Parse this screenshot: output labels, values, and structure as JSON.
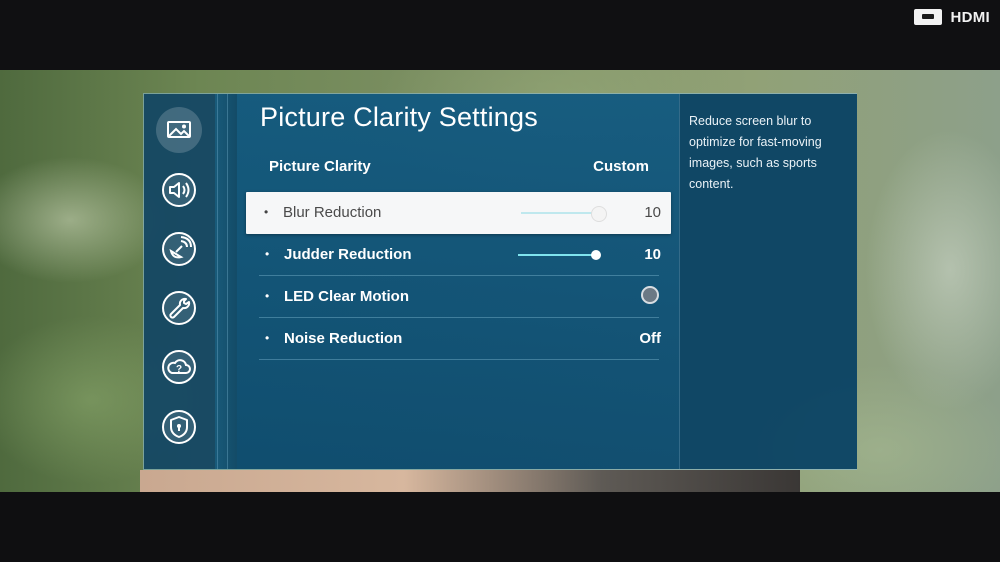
{
  "input_source": {
    "label": "HDMI",
    "icon": "hdmi-icon"
  },
  "menu": {
    "title": "Picture Clarity Settings",
    "rail": [
      {
        "name": "picture",
        "icon": "picture-icon",
        "active": true
      },
      {
        "name": "sound",
        "icon": "sound-icon",
        "active": false
      },
      {
        "name": "broadcasting",
        "icon": "satellite-icon",
        "active": false
      },
      {
        "name": "general",
        "icon": "wrench-icon",
        "active": false
      },
      {
        "name": "support",
        "icon": "help-cloud-icon",
        "active": false
      },
      {
        "name": "privacy",
        "icon": "shield-icon",
        "active": false
      }
    ],
    "header": {
      "label": "Picture Clarity",
      "value": "Custom"
    },
    "items": [
      {
        "label": "Blur Reduction",
        "type": "slider",
        "value": "10",
        "level": 1.0,
        "focused": true
      },
      {
        "label": "Judder Reduction",
        "type": "slider",
        "value": "10",
        "level": 1.0,
        "focused": false
      },
      {
        "label": "LED Clear Motion",
        "type": "toggle",
        "checked": false,
        "focused": false
      },
      {
        "label": "Noise Reduction",
        "type": "value",
        "value": "Off",
        "focused": false
      }
    ],
    "help_text": "Reduce screen blur to optimize for fast-moving images, such as sports content."
  }
}
